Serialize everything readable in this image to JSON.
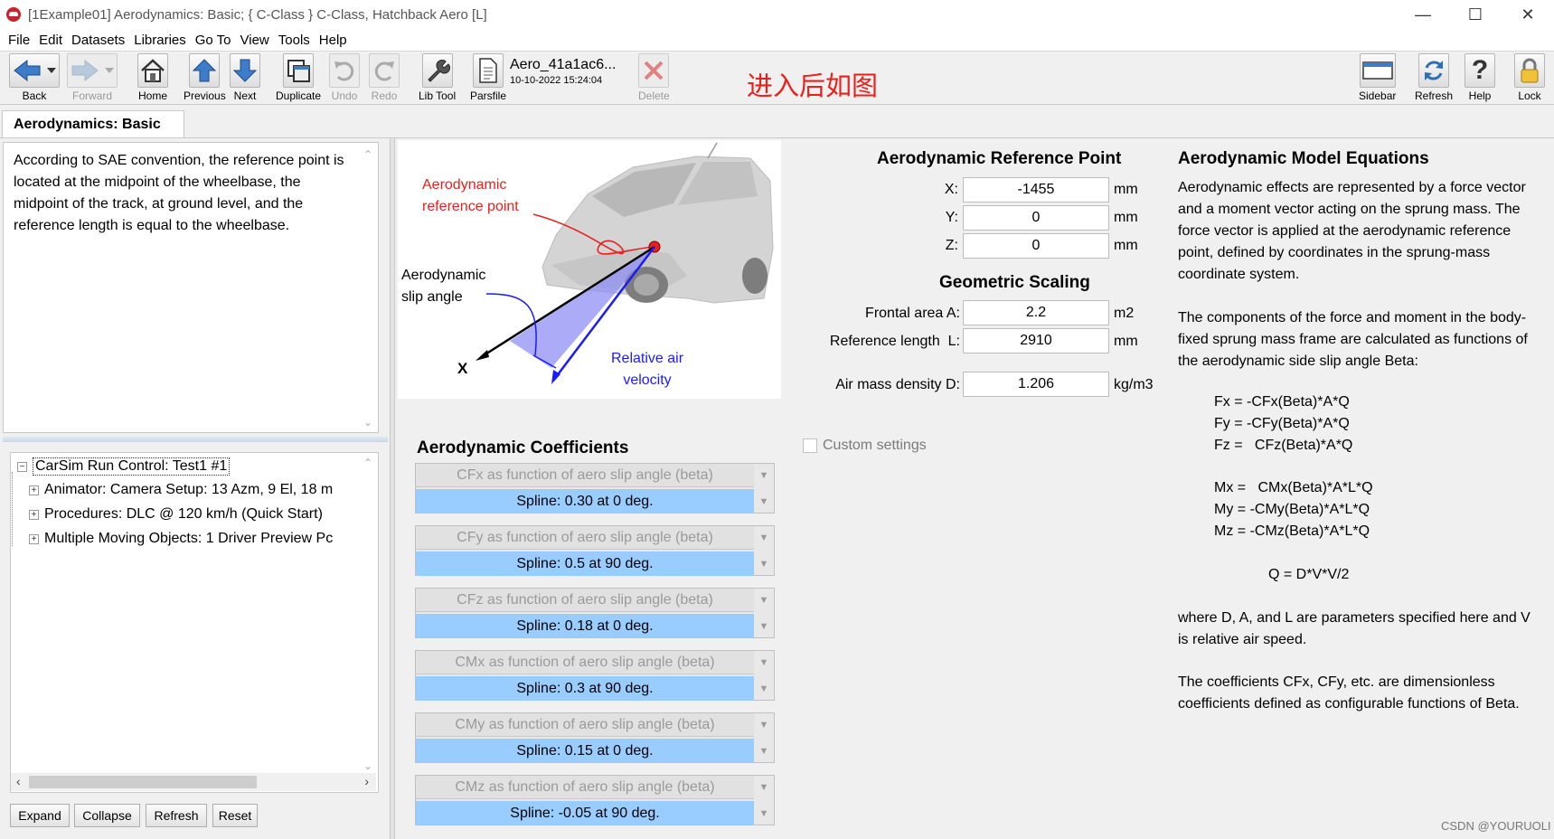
{
  "window": {
    "title": "[1Example01] Aerodynamics: Basic; { C-Class } C-Class, Hatchback Aero [L]"
  },
  "menu": [
    "File",
    "Edit",
    "Datasets",
    "Libraries",
    "Go To",
    "View",
    "Tools",
    "Help"
  ],
  "toolbar": {
    "back": "Back",
    "forward": "Forward",
    "home": "Home",
    "previous": "Previous",
    "next": "Next",
    "duplicate": "Duplicate",
    "undo": "Undo",
    "redo": "Redo",
    "lib_tool": "Lib Tool",
    "parsfile": "Parsfile",
    "parsfile_name": "Aero_41a1ac6...",
    "parsfile_date": "10-10-2022 15:24:04",
    "delete": "Delete",
    "sidebar": "Sidebar",
    "refresh": "Refresh",
    "help": "Help",
    "lock": "Lock"
  },
  "annotation": "进入后如图",
  "tab": "Aerodynamics: Basic",
  "description": "According to SAE convention, the reference point is located at the midpoint of the wheelbase, the midpoint of the track, at ground level, and the reference length is equal to the wheelbase.",
  "tree": {
    "root": "CarSim Run Control: Test1 #1",
    "children": [
      "Animator: Camera Setup: 13 Azm, 9 El, 18 m",
      "Procedures: DLC @ 120 km/h (Quick Start)",
      "Multiple Moving Objects: 1 Driver Preview Pc"
    ]
  },
  "tree_buttons": [
    "Expand",
    "Collapse",
    "Refresh",
    "Reset"
  ],
  "figure": {
    "label_ref": "Aerodynamic\nreference point",
    "label_ref_1": "Aerodynamic",
    "label_ref_2": "reference point",
    "label_slip_1": "Aerodynamic",
    "label_slip_2": "slip angle",
    "label_air_1": "Relative air",
    "label_air_2": "velocity",
    "label_x": "X"
  },
  "ref_point": {
    "title": "Aerodynamic Reference Point",
    "x_label": "X:",
    "x_value": "-1455",
    "x_unit": "mm",
    "y_label": "Y:",
    "y_value": "0",
    "y_unit": "mm",
    "z_label": "Z:",
    "z_value": "0",
    "z_unit": "mm"
  },
  "scaling": {
    "title": "Geometric Scaling",
    "area_label": "Frontal area A:",
    "area_value": "2.2",
    "area_unit": "m2",
    "length_label": "Reference length  L:",
    "length_value": "2910",
    "length_unit": "mm",
    "density_label": "Air mass density D:",
    "density_value": "1.206",
    "density_unit": "kg/m3"
  },
  "custom_settings": "Custom settings",
  "coefficients": {
    "title": "Aerodynamic Coefficients",
    "items": [
      {
        "func": "CFx as function of aero slip angle (beta)",
        "value": "Spline: 0.30 at 0 deg."
      },
      {
        "func": "CFy as function of aero slip angle (beta)",
        "value": "Spline: 0.5 at 90 deg."
      },
      {
        "func": "CFz as function of aero slip angle (beta)",
        "value": "Spline: 0.18 at 0 deg."
      },
      {
        "func": "CMx as function of aero slip angle (beta)",
        "value": "Spline: 0.3 at 90 deg."
      },
      {
        "func": "CMy as function of aero slip angle (beta)",
        "value": "Spline: 0.15 at 0 deg."
      },
      {
        "func": "CMz as function of aero slip angle (beta)",
        "value": "Spline: -0.05 at 90 deg."
      }
    ]
  },
  "equations": {
    "title": "Aerodynamic Model Equations",
    "p1": "Aerodynamic effects are represented by a force vector and a moment vector acting on the sprung mass. The force vector is applied at the aerodynamic reference point, defined by coordinates in the sprung-mass coordinate system.",
    "p2": "The components of the force and moment in the body-fixed sprung mass frame are calculated as functions of the aerodynamic side slip angle Beta:",
    "fx": "Fx = -CFx(Beta)*A*Q",
    "fy": "Fy = -CFy(Beta)*A*Q",
    "fz": "Fz =   CFz(Beta)*A*Q",
    "mx": "Mx =   CMx(Beta)*A*L*Q",
    "my": "My = -CMy(Beta)*A*L*Q",
    "mz": "Mz = -CMz(Beta)*A*L*Q",
    "q": "Q = D*V*V/2",
    "p3": "where D, A, and L are parameters specified here and V is relative air speed.",
    "p4": "The coefficients CFx, CFy, etc. are dimensionless coefficients defined as configurable functions of Beta."
  },
  "watermark": "CSDN @YOURUOLI",
  "colors": {
    "accent_blue": "#99ccff",
    "annotation_red": "#e8211b",
    "figure_red": "#e8211b",
    "figure_blue": "#1a1aff"
  }
}
